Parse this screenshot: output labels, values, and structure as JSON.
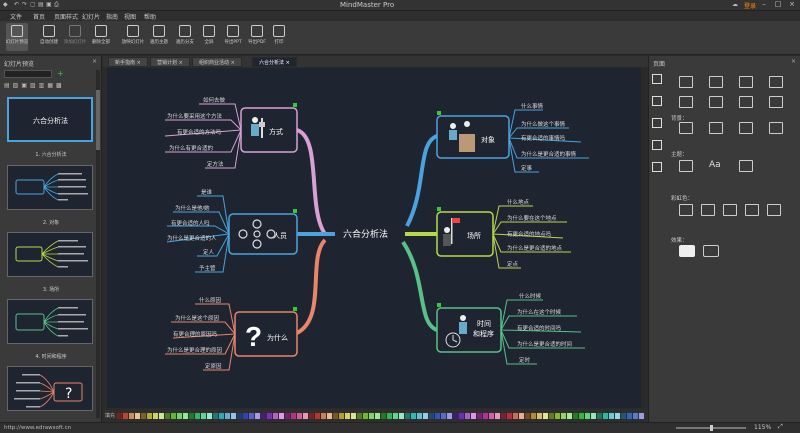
{
  "window": {
    "title": "MindMaster Pro",
    "login": "登录"
  },
  "menu": [
    "文件",
    "首页",
    "页面样式",
    "幻灯片",
    "指南",
    "视图",
    "帮助"
  ],
  "ribbon": [
    "幻灯片预览",
    "自动创建",
    "添加幻灯片",
    "删除全部",
    "放映幻灯片",
    "遍历主题",
    "遍历分支",
    "全屏",
    "导出PPT",
    "导出PDF",
    "打印"
  ],
  "left_panel": {
    "title": "幻灯片预览",
    "captions": [
      "1. 六合分析法",
      "2. 对象",
      "3. 场所",
      "4. 时间和程序"
    ],
    "thumb1_title": "六合分析法"
  },
  "tabs": [
    "新手指南",
    "营销计划",
    "组织商业活动",
    "六合分析法"
  ],
  "right_panel": {
    "title": "页面",
    "bg": "背景：",
    "theme": "主题：",
    "color": "彩虹色：",
    "effect": "效果："
  },
  "mindmap": {
    "center": "六合分析法",
    "fangshi": {
      "label": "方式",
      "items": [
        "如何去做",
        "为什么要采用这个方法",
        "有更合适的方法吗",
        "为什么有更合适的",
        "定方法"
      ]
    },
    "renyuan": {
      "label": "人员",
      "items": [
        "是谁",
        "为什么是他/她",
        "有更合适的人吗",
        "为什么是更合适的人",
        "定人",
        "予主管"
      ]
    },
    "weishenme": {
      "label": "为什么",
      "items": [
        "什么原因",
        "为什么是这个原因",
        "有更合理的原因吗",
        "为什么是更合理的原因",
        "定原因"
      ]
    },
    "duixiang": {
      "label": "对象",
      "items": [
        "什么事情",
        "为什么做这个事情",
        "有更合适的事情吗",
        "为什么是更合适的事情",
        "定事"
      ]
    },
    "changsuo": {
      "label": "场所",
      "items": [
        "什么地点",
        "为什么要在这个地点",
        "有更合适的地点吗",
        "为什么是更合适的地点",
        "定点"
      ]
    },
    "shijian": {
      "label1": "时间",
      "label2": "和程序",
      "items": [
        "什么时候",
        "为什么在这个时候",
        "有更合适的时间吗",
        "为什么是更合适的时间",
        "定时"
      ]
    }
  },
  "status": {
    "url": "http://www.edrawsoft.cn",
    "zoom": "115%",
    "color_label": "填充"
  }
}
